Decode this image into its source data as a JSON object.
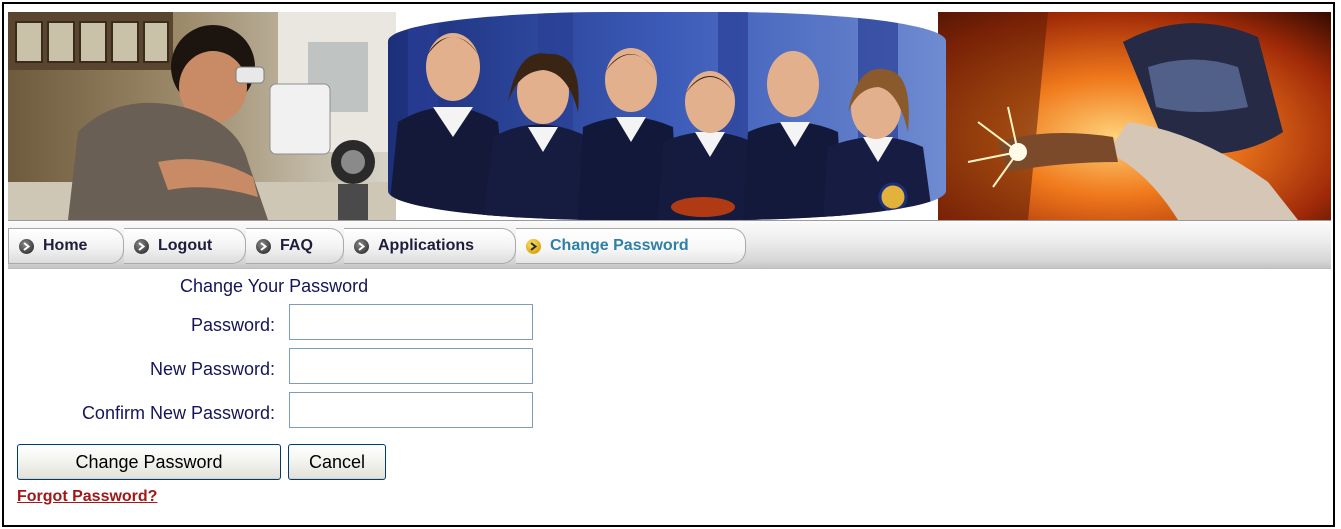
{
  "nav": {
    "tabs": [
      {
        "label": "Home",
        "active": false
      },
      {
        "label": "Logout",
        "active": false
      },
      {
        "label": "FAQ",
        "active": false
      },
      {
        "label": "Applications",
        "active": false
      },
      {
        "label": "Change Password",
        "active": true
      }
    ]
  },
  "form": {
    "title": "Change Your Password",
    "password_label": "Password:",
    "new_password_label": "New Password:",
    "confirm_label": "Confirm New Password:",
    "password_value": "",
    "new_password_value": "",
    "confirm_value": "",
    "submit_label": "Change Password",
    "cancel_label": "Cancel",
    "forgot_link": "Forgot Password?"
  },
  "colors": {
    "label_text": "#14145a",
    "active_tab_text": "#2f7fa6",
    "link": "#a01818"
  },
  "banner": {
    "images": [
      "student-microscope-photo",
      "ffa-officers-group-photo",
      "welder-sparks-photo"
    ]
  }
}
